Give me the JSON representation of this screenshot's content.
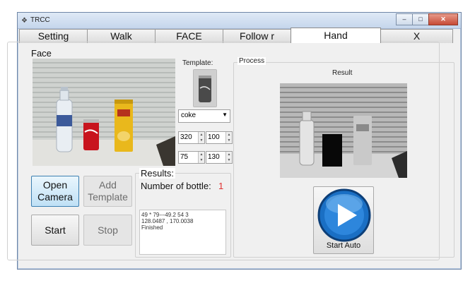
{
  "window": {
    "title": "TRCC",
    "icon": "app-icon"
  },
  "tabs": [
    {
      "label": "Setting"
    },
    {
      "label": "Walk"
    },
    {
      "label": "FACE"
    },
    {
      "label": "Follow r"
    },
    {
      "label": "Hand"
    },
    {
      "label": "X"
    }
  ],
  "face": {
    "group_label": "Face",
    "template_label": "Template:",
    "template_select": "coke",
    "spin": [
      "320",
      "100",
      "75",
      "130"
    ],
    "results_label": "Results:",
    "bottle_label": "Number of bottle:",
    "bottle_count": "1",
    "output_lines": [
      "49 * 79---49.2 54 3",
      "128.0487 , 170.0038",
      "Finished"
    ],
    "buttons": {
      "open_camera": "Open Camera",
      "add_template": "Add Template",
      "start": "Start",
      "stop": "Stop"
    }
  },
  "process": {
    "group_label": "Process",
    "result_label": "Result",
    "start_auto": "Start Auto"
  },
  "colors": {
    "accent": "#1a6fc4",
    "count": "#e03030"
  }
}
